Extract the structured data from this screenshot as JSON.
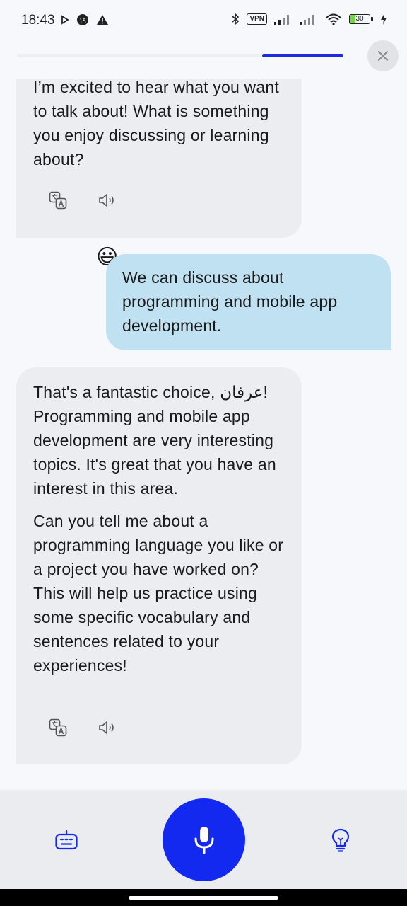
{
  "status_bar": {
    "time": "18:43",
    "vpn": "VPN",
    "battery_level": "30",
    "battery_fraction": 0.3
  },
  "progress": {
    "fraction": 0.25,
    "color": "#1a2be0"
  },
  "chat": {
    "messages": [
      {
        "role": "assistant",
        "paragraphs": [
          "I’m excited to hear what you want to talk about! What is something you enjoy discussing or learning about?"
        ]
      },
      {
        "role": "user",
        "emoji": "😃",
        "paragraphs": [
          "We can discuss about programming and mobile app development."
        ]
      },
      {
        "role": "assistant",
        "paragraphs": [
          "That's a fantastic choice, عرفان! Programming and mobile app development are very interesting topics. It's great that you have an interest in this area.",
          "Can you tell me about a programming language you like or a project you have worked on? This will help us practice using some specific vocabulary and sentences related to your experiences!"
        ]
      }
    ]
  },
  "icons": {
    "close": "close-icon",
    "translate": "translate-icon",
    "speaker": "speaker-icon",
    "keyboard": "robot-keyboard-icon",
    "mic": "microphone-icon",
    "hint": "lightbulb-icon"
  },
  "colors": {
    "accent": "#1429f0",
    "user_bubble": "#bfe1f2",
    "bot_bubble": "#ebedf1"
  }
}
